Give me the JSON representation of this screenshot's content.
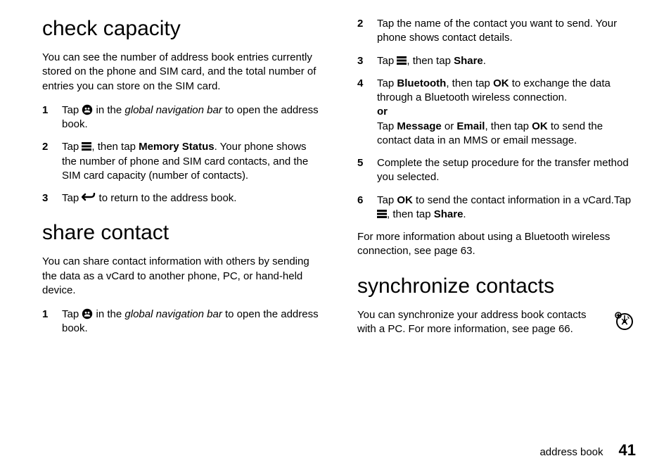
{
  "left": {
    "h1a": "check capacity",
    "p1": "You can see the number of address book entries currently stored on the phone and SIM card, and the total number of entries you can store on the SIM card.",
    "steps_a": [
      {
        "num": "1",
        "pre": "Tap ",
        "icon": "contacts-icon",
        "mid": " in the ",
        "ital": "global navigation bar",
        "post": " to open the address book."
      },
      {
        "num": "2",
        "pre": "Tap ",
        "icon": "menu-icon",
        "mid": ", then tap ",
        "bold": "Memory Status",
        "post": ". Your phone shows the number of phone and SIM card contacts, and the SIM card capacity (number of contacts)."
      },
      {
        "num": "3",
        "pre": "Tap ",
        "icon": "back-icon",
        "post": " to return to the address book."
      }
    ],
    "h1b": "share contact",
    "p2": "You can share contact information with others by sending the data as a vCard to another phone, PC, or hand-held device.",
    "steps_b": [
      {
        "num": "1",
        "pre": "Tap ",
        "icon": "contacts-icon",
        "mid": " in the ",
        "ital": "global navigation bar",
        "post": " to open the address book."
      }
    ]
  },
  "right": {
    "steps": [
      {
        "num": "2",
        "text": "Tap the name of the contact you want to send. Your phone shows contact details."
      },
      {
        "num": "3",
        "pre": "Tap ",
        "icon": "menu-icon",
        "mid": ", then tap ",
        "bold": "Share",
        "post": "."
      },
      {
        "num": "4",
        "pre": "Tap ",
        "bold1": "Bluetooth",
        "mid1": ", then tap ",
        "bold2": "OK",
        "mid2": " to exchange the data through a Bluetooth wireless connection.",
        "or": "or",
        "pre2": "Tap ",
        "bold3": "Message",
        "mid3": " or ",
        "bold4": "Email",
        "mid4": ", then tap ",
        "bold5": "OK",
        "post2": " to send the contact data in an MMS or email message."
      },
      {
        "num": "5",
        "text": "Complete the setup procedure for the transfer method you selected."
      },
      {
        "num": "6",
        "pre": "Tap ",
        "bold1": "OK",
        "mid1": " to send the contact information in a vCard.Tap ",
        "icon": "menu-icon",
        "mid2": ", then tap ",
        "bold2": "Share",
        "post": "."
      }
    ],
    "p_after": "For more information about using a Bluetooth wireless connection, see page 63.",
    "h1": "synchronize contacts",
    "p_sync": "You can synchronize your address book contacts with a PC. For more information, see page 66."
  },
  "footer": {
    "section": "address book",
    "page": "41"
  }
}
